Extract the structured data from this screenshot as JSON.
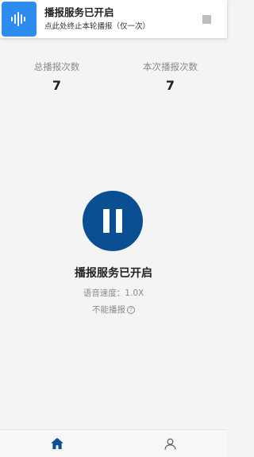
{
  "notification": {
    "title": "播报服务已开启",
    "subtitle": "点此处终止本轮播报（仅一次）",
    "icon": "sound-wave-icon",
    "stop_icon": "stop-square-icon"
  },
  "stats": {
    "total_label": "总播报次数",
    "total_value": "7",
    "current_label": "本次播报次数",
    "current_value": "7"
  },
  "player": {
    "button_icon": "pause-icon",
    "status": "播报服务已开启",
    "speed": "语音速度：1.0X",
    "cannot_broadcast": "不能播报",
    "help_icon": "question-circle-icon"
  },
  "bottom_nav": {
    "items": [
      {
        "icon": "home-icon",
        "active": true
      },
      {
        "icon": "user-icon",
        "active": false
      }
    ]
  },
  "colors": {
    "accent": "#0a4f91",
    "notification_icon_bg": "#2d8cf0",
    "background": "#f4f4f4",
    "muted_text": "#8a8a8a"
  }
}
